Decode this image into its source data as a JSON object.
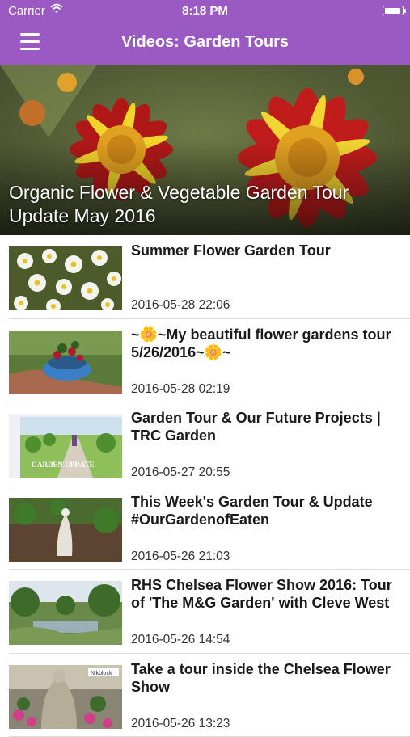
{
  "status_bar": {
    "carrier": "Carrier",
    "time": "8:18 PM"
  },
  "nav": {
    "title": "Videos: Garden Tours",
    "menu_icon": "hamburger-menu-icon"
  },
  "featured": {
    "title": "Organic Flower & Vegetable Garden Tour Update May 2016"
  },
  "videos": [
    {
      "title": "Summer Flower Garden Tour",
      "date": "2016-05-28 22:06"
    },
    {
      "title": "~🌼~My beautiful flower gardens tour 5/26/2016~🌼~",
      "date": "2016-05-28 02:19"
    },
    {
      "title": "Garden Tour & Our Future Projects | TRC Garden",
      "date": "2016-05-27 20:55",
      "thumb_text": "GARDEN UPDATE"
    },
    {
      "title": "This Week's Garden Tour & Update #OurGardenofEaten",
      "date": "2016-05-26 21:03"
    },
    {
      "title": "RHS Chelsea Flower Show 2016: Tour of 'The M&G Garden' with Cleve West",
      "date": "2016-05-26 14:54"
    },
    {
      "title": "Take a tour inside the Chelsea Flower Show",
      "date": "2016-05-26 13:23",
      "thumb_text": "Nikblock"
    }
  ],
  "colors": {
    "accent": "#9b59c4",
    "date_text": "#333333",
    "separator": "#dcdcdc"
  }
}
